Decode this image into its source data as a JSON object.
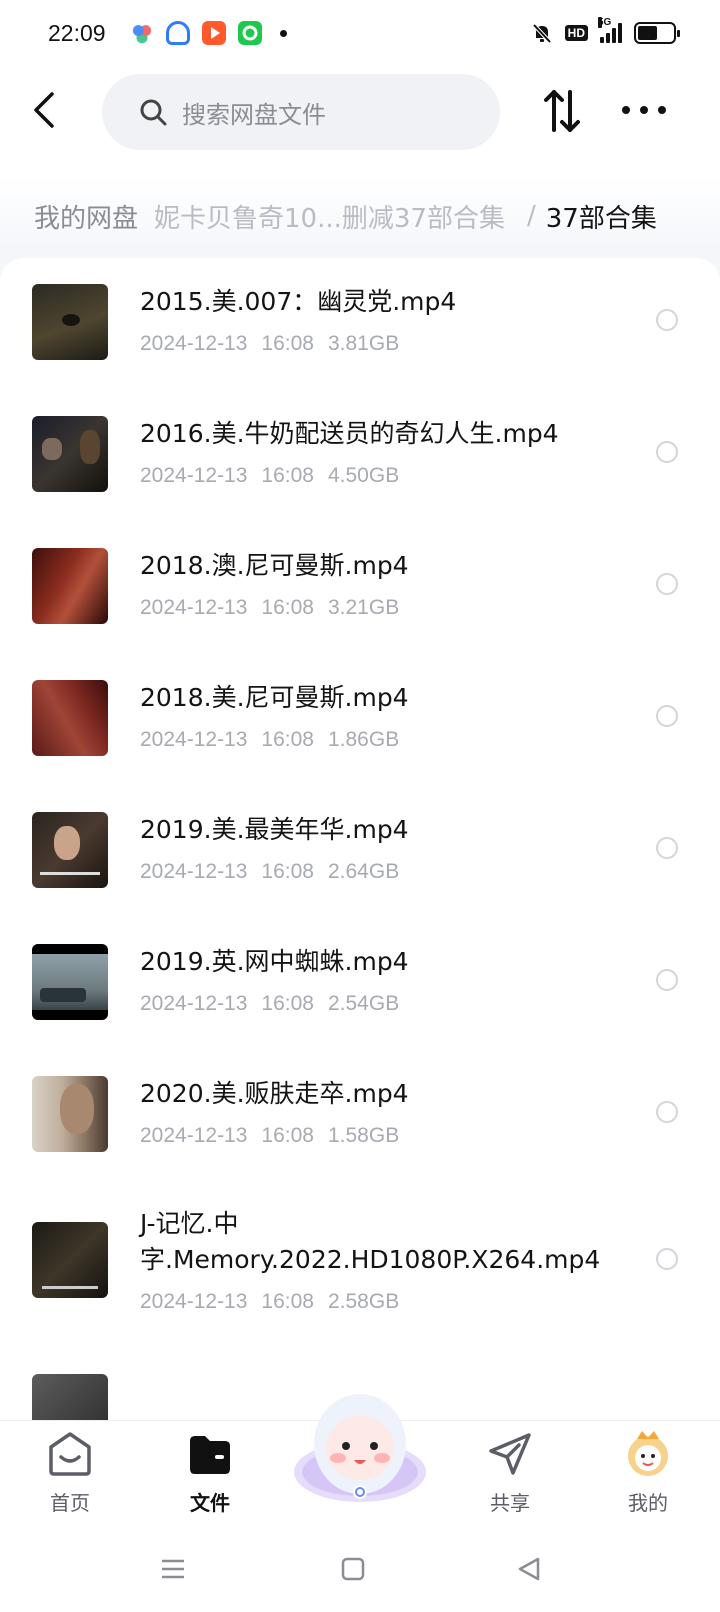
{
  "status_bar": {
    "time": "22:09",
    "hd_badge": "HD",
    "network": "5G",
    "battery_level": 0.55
  },
  "header": {
    "back_icon": "chevron-left-icon",
    "search_placeholder": "搜索网盘文件",
    "sort_icon": "sort-arrows-icon",
    "more_icon": "more-dots-icon"
  },
  "breadcrumb": {
    "root": "我的网盘",
    "middle": "妮卡贝鲁奇10...删减37部合集",
    "separator": "/",
    "current": "37部合集"
  },
  "files": [
    {
      "name": "2015.美.007：幽灵党.mp4",
      "date": "2024-12-13",
      "time": "16:08",
      "size": "3.81GB"
    },
    {
      "name": "2016.美.牛奶配送员的奇幻人生.mp4",
      "date": "2024-12-13",
      "time": "16:08",
      "size": "4.50GB"
    },
    {
      "name": "2018.澳.尼可曼斯.mp4",
      "date": "2024-12-13",
      "time": "16:08",
      "size": "3.21GB"
    },
    {
      "name": "2018.美.尼可曼斯.mp4",
      "date": "2024-12-13",
      "time": "16:08",
      "size": "1.86GB"
    },
    {
      "name": "2019.美.最美年华.mp4",
      "date": "2024-12-13",
      "time": "16:08",
      "size": "2.64GB"
    },
    {
      "name": "2019.英.网中蜘蛛.mp4",
      "date": "2024-12-13",
      "time": "16:08",
      "size": "2.54GB"
    },
    {
      "name": "2020.美.贩肤走卒.mp4",
      "date": "2024-12-13",
      "time": "16:08",
      "size": "1.58GB"
    },
    {
      "name": "J-记忆.中字.Memory.2022.HD1080P.X264.mp4",
      "date": "2024-12-13",
      "time": "16:08",
      "size": "2.58GB"
    }
  ],
  "bottom_nav": [
    {
      "label": "首页",
      "icon": "home-icon"
    },
    {
      "label": "文件",
      "icon": "folder-icon"
    },
    {
      "label": "共享",
      "icon": "share-icon"
    },
    {
      "label": "我的",
      "icon": "avatar-icon"
    }
  ],
  "colors": {
    "background": "#f4f6fa",
    "text_primary": "#141414",
    "text_secondary": "#a7aab0"
  }
}
